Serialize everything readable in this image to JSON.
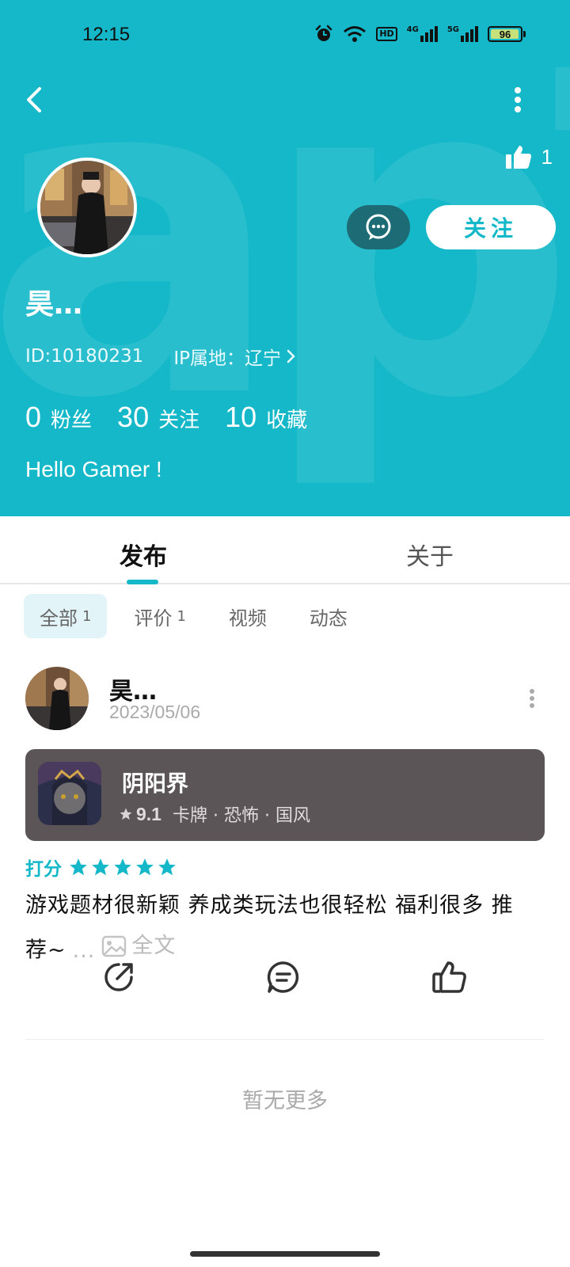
{
  "status_bar": {
    "time": "12:15",
    "hd_label": "HD",
    "net1": "4G",
    "net2": "5G",
    "battery": "96",
    "battery_level": 0.96
  },
  "header": {
    "watermark": "apTa",
    "like_count": "1",
    "follow_label": "关注",
    "username": "昊…",
    "id_text": "ID:10180231",
    "ip_text": "IP属地：辽宁",
    "stats": [
      {
        "num": "0",
        "label": "粉丝"
      },
      {
        "num": "30",
        "label": "关注"
      },
      {
        "num": "10",
        "label": "收藏"
      }
    ],
    "bio": "Hello Gamer !"
  },
  "tabs": [
    {
      "label": "发布",
      "active": true
    },
    {
      "label": "关于",
      "active": false
    }
  ],
  "filters": [
    {
      "label": "全部",
      "count": "1",
      "active": true
    },
    {
      "label": "评价",
      "count": "1",
      "active": false
    },
    {
      "label": "视频",
      "count": "",
      "active": false
    },
    {
      "label": "动态",
      "count": "",
      "active": false
    }
  ],
  "post": {
    "author": "昊…",
    "date": "2023/05/06",
    "game": {
      "name": "阴阳界",
      "score": "9.1",
      "tags": "卡牌 · 恐怖 · 国风"
    },
    "rating_label": "打分",
    "stars": 5,
    "text": "游戏题材很新颖 养成类玩法也很轻松 福利很多 推荐~",
    "ellipsis": "...",
    "fulltext": "全文"
  },
  "footer": {
    "no_more": "暂无更多"
  },
  "colors": {
    "accent": "#14b8c8",
    "message_button": "#1c6b75",
    "game_card": "#5b5558"
  }
}
